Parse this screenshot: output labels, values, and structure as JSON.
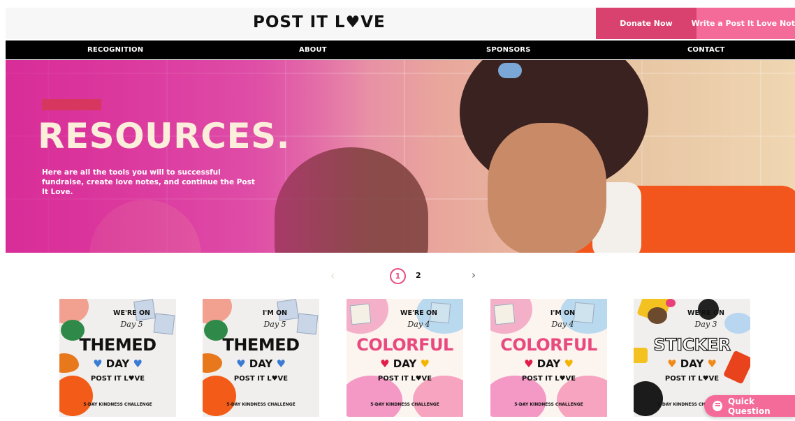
{
  "header": {
    "logo_text": "POST IT L♥VE",
    "donate_label": "Donate Now",
    "write_label": "Write a Post It Love Note"
  },
  "nav": {
    "items": [
      "RECOGNITION",
      "ABOUT",
      "SPONSORS",
      "CONTACT"
    ]
  },
  "hero": {
    "title": "RESOURCES.",
    "subtitle": "Here are all the tools you will to successful fundraise, create love notes, and continue the Post It Love."
  },
  "pagination": {
    "prev": "‹",
    "pages": [
      "1",
      "2"
    ],
    "current": "1",
    "next": "›"
  },
  "cards": [
    {
      "top": "WE'RE ON",
      "day": "Day 5",
      "big": "THEMED",
      "mid": "DAY",
      "brand": "POST IT L♥VE",
      "foot": "5-DAY KINDNESS CHALLENGE",
      "heart": "blue"
    },
    {
      "top": "I'M ON",
      "day": "Day 5",
      "big": "THEMED",
      "mid": "DAY",
      "brand": "POST IT L♥VE",
      "foot": "5-DAY KINDNESS CHALLENGE",
      "heart": "blue"
    },
    {
      "top": "WE'RE ON",
      "day": "Day 4",
      "big": "COLORFUL",
      "mid": "DAY",
      "brand": "POST IT L♥VE",
      "foot": "5-DAY KINDNESS CHALLENGE",
      "heart": "red"
    },
    {
      "top": "I'M ON",
      "day": "Day 4",
      "big": "COLORFUL",
      "mid": "DAY",
      "brand": "POST IT L♥VE",
      "foot": "5-DAY KINDNESS CHALLENGE",
      "heart": "red"
    },
    {
      "top": "WE'RE ON",
      "day": "Day 3",
      "big": "STICKER",
      "mid": "DAY",
      "brand": "POST IT L♥VE",
      "foot": "5-DAY KINDNESS CHALLENGE",
      "heart": "orange"
    }
  ],
  "quick_question": {
    "label": "Quick Question"
  },
  "colors": {
    "donate": "#d9426e",
    "write": "#f46b9a",
    "nav_bg": "#000000",
    "accent_bar": "#d7375e",
    "hero_title": "#fbeedb"
  },
  "icons": [
    "heart-icon",
    "chevron-left-icon",
    "chevron-right-icon",
    "chat-bubble-icon"
  ]
}
